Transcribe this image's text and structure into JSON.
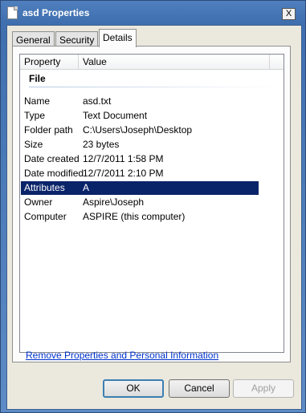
{
  "window": {
    "title": "asd Properties",
    "close_glyph": "X"
  },
  "tabs": [
    {
      "label": "General"
    },
    {
      "label": "Security"
    },
    {
      "label": "Details"
    }
  ],
  "list": {
    "columns": [
      "Property",
      "Value"
    ],
    "group": "File",
    "rows": [
      {
        "property": "Name",
        "value": "asd.txt"
      },
      {
        "property": "Type",
        "value": "Text Document"
      },
      {
        "property": "Folder path",
        "value": "C:\\Users\\Joseph\\Desktop"
      },
      {
        "property": "Size",
        "value": "23 bytes"
      },
      {
        "property": "Date created",
        "value": "12/7/2011 1:58 PM"
      },
      {
        "property": "Date modified",
        "value": "12/7/2011 2:10 PM"
      },
      {
        "property": "Attributes",
        "value": "A"
      },
      {
        "property": "Owner",
        "value": "Aspire\\Joseph"
      },
      {
        "property": "Computer",
        "value": "ASPIRE (this computer)"
      }
    ],
    "selected_row": "Attributes"
  },
  "link": {
    "label": "Remove Properties and Personal Information"
  },
  "buttons": {
    "ok": "OK",
    "cancel": "Cancel",
    "apply": "Apply"
  },
  "colors": {
    "selection": "#0a246a",
    "link": "#0033cc"
  }
}
